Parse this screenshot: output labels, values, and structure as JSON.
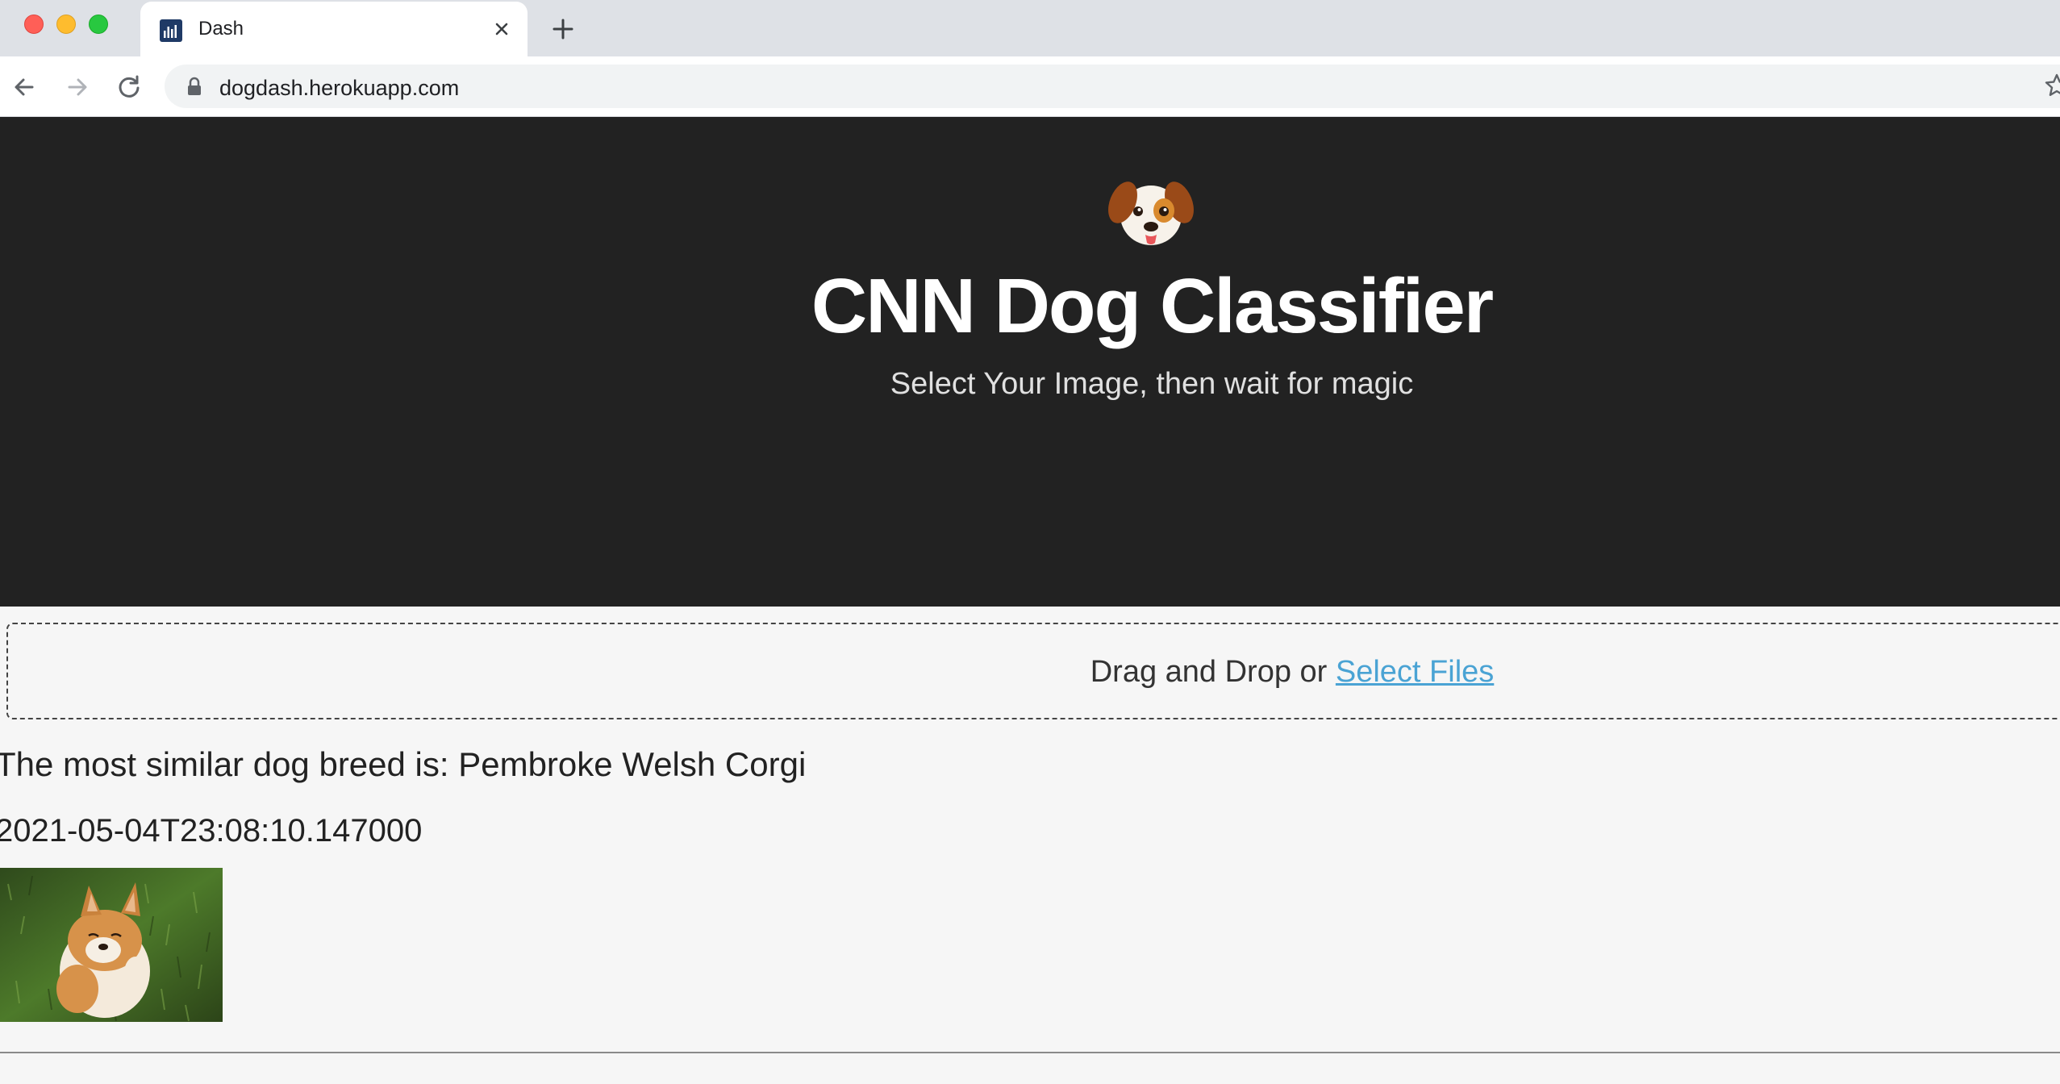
{
  "browser": {
    "tab_title": "Dash",
    "url": "dogdash.herokuapp.com"
  },
  "hero": {
    "logo_icon": "dog-face-icon",
    "title": "CNN Dog Classifier",
    "subtitle": "Select Your Image, then wait for magic"
  },
  "upload": {
    "prefix": "Drag and Drop or ",
    "link_label": "Select Files"
  },
  "result": {
    "prediction_text": "The most similar dog breed is: Pembroke Welsh Corgi",
    "timestamp": "2021-05-04T23:08:10.147000",
    "image_description": "corgi-photo"
  },
  "colors": {
    "hero_background": "#222222",
    "page_background": "#f6f6f6",
    "link": "#4aa3d4"
  }
}
